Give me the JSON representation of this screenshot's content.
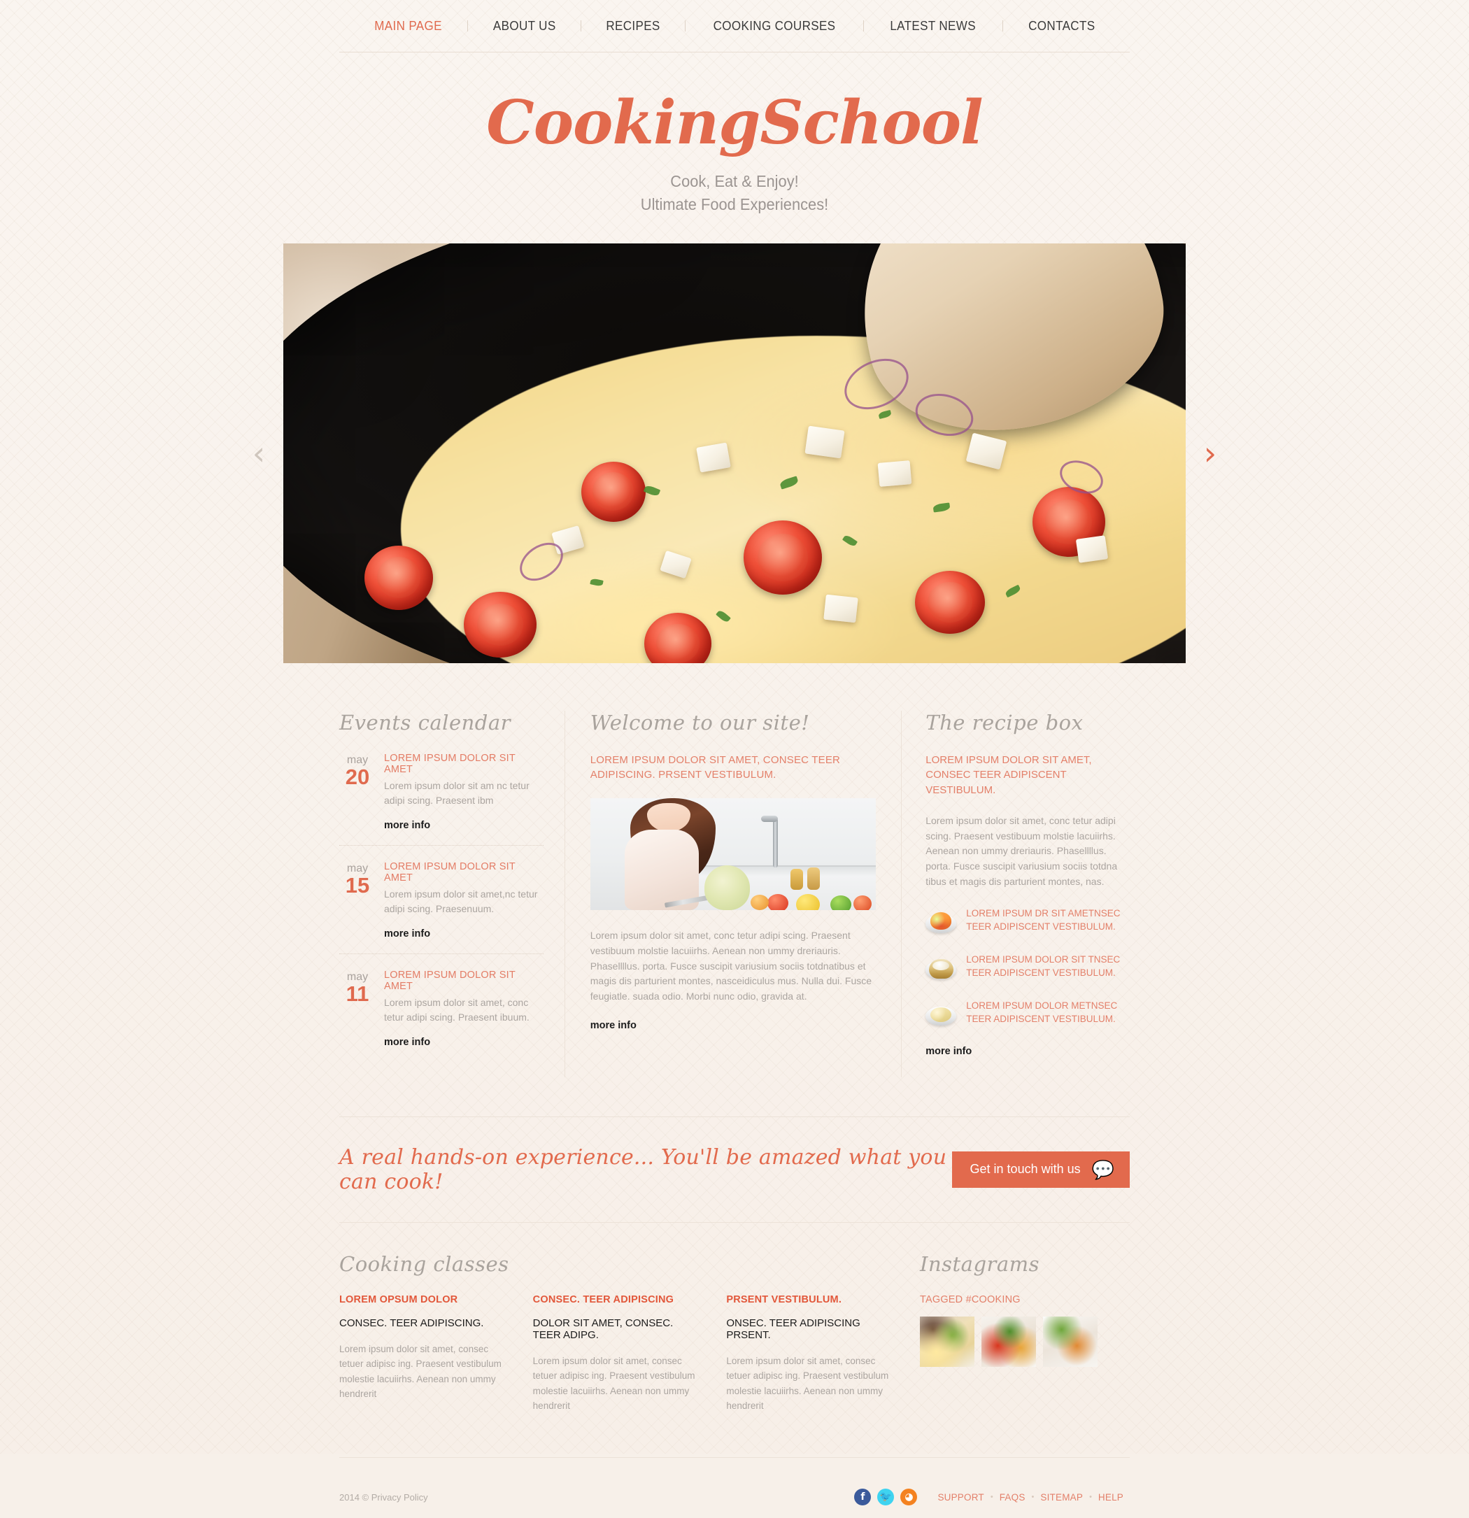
{
  "nav": {
    "items": [
      {
        "label": "MAIN PAGE",
        "active": true
      },
      {
        "label": "ABOUT US",
        "active": false
      },
      {
        "label": "RECIPES",
        "active": false
      },
      {
        "label": "COOKING COURSES",
        "active": false
      },
      {
        "label": "LATEST NEWS",
        "active": false
      },
      {
        "label": "CONTACTS",
        "active": false
      }
    ]
  },
  "brand": {
    "title": "CookingSchool",
    "tagline_line1": "Cook, Eat & Enjoy!",
    "tagline_line2": "Ultimate Food Experiences!"
  },
  "slider": {
    "prev_icon": "chevron-left",
    "next_icon": "chevron-right",
    "slide_alt": "Skillet of scrambled eggs with cherry tomatoes, feta cheese, red onion and herbs"
  },
  "events": {
    "heading": "Events calendar",
    "items": [
      {
        "month": "may",
        "day": "20",
        "title": "LOREM IPSUM DOLOR SIT AMET",
        "text": "Lorem ipsum dolor sit am nc tetur adipi scing. Praesent ibm",
        "link": "more info"
      },
      {
        "month": "may",
        "day": "15",
        "title": "LOREM IPSUM DOLOR SIT AMET",
        "text": "Lorem ipsum dolor sit amet,nc tetur adipi scing. Praesenuum.",
        "link": "more info"
      },
      {
        "month": "may",
        "day": "11",
        "title": "LOREM IPSUM DOLOR SIT AMET",
        "text": "Lorem ipsum dolor sit amet, conc tetur adipi scing. Praesent ibuum.",
        "link": "more info"
      }
    ]
  },
  "welcome": {
    "heading": "Welcome to our site!",
    "lead": "LOREM IPSUM DOLOR SIT AMET, CONSEC TEER ADIPISCING. PRSENT VESTIBULUM.",
    "photo_alt": "Smiling woman chopping vegetables in a white kitchen",
    "text": "Lorem ipsum dolor sit amet, conc tetur adipi scing. Praesent vestibuum molstie lacuiirhs. Aenean non ummy dreriauris. Phasellllus. porta. Fusce suscipit variusium sociis totdnatibus et magis dis parturient montes, nasceidiculus mus. Nulla dui. Fusce feugiatle. suada odio. Morbi nunc odio, gravida at.",
    "link": "more info"
  },
  "recipe_box": {
    "heading": "The recipe box",
    "lead": "LOREM IPSUM DOLOR SIT AMET, CONSEC TEER ADIPISCENT VESTIBULUM.",
    "text": "Lorem ipsum dolor sit amet, conc tetur adipi scing. Praesent vestibuum molstie lacuiirhs. Aenean non ummy dreriauris. Phasellllus. porta. Fusce suscipit variusium sociis totdna tibus et magis dis parturient montes, nas.",
    "items": [
      {
        "thumb": "stir-fry-plate-icon",
        "title": "LOREM IPSUM DR SIT AMETNSEC TEER ADIPISCENT VESTIBULUM."
      },
      {
        "thumb": "dumpling-basket-icon",
        "title": "LOREM IPSUM DOLOR SIT TNSEC TEER ADIPISCENT VESTIBULUM."
      },
      {
        "thumb": "rice-plate-icon",
        "title": "LOREM IPSUM DOLOR METNSEC TEER ADIPISCENT VESTIBULUM."
      }
    ],
    "link": "more info"
  },
  "cta": {
    "text": "A real hands-on experience... You'll be amazed what you can cook!",
    "button_label": "Get in touch  with us",
    "button_icon": "speech-bubble-icon",
    "button_color": "#e26a4d"
  },
  "classes": {
    "heading": "Cooking classes",
    "columns": [
      {
        "title": "LOREM OPSUM DOLOR",
        "subtitle": "CONSEC. TEER ADIPISCING.",
        "text": "Lorem ipsum dolor sit amet, consec tetuer adipisc ing. Praesent vestibulum molestie lacuiirhs. Aenean non ummy hendrerit"
      },
      {
        "title": "CONSEC. TEER ADIPISCING",
        "subtitle": "DOLOR SIT AMET, CONSEC. TEER ADIPG.",
        "text": "Lorem ipsum dolor sit amet, consec tetuer adipisc ing. Praesent vestibulum molestie lacuiirhs. Aenean non ummy hendrerit"
      },
      {
        "title": "PRSENT VESTIBULUM.",
        "subtitle": "ONSEC. TEER ADIPISCING PRSENT.",
        "text": "Lorem ipsum dolor sit amet, consec tetuer adipisc ing. Praesent vestibulum molestie lacuiirhs. Aenean non ummy hendrerit"
      }
    ]
  },
  "instagrams": {
    "heading": "Instagrams",
    "tag": "TAGGED #COOKING",
    "thumbs": [
      {
        "alt": "pizza slice with basil"
      },
      {
        "alt": "grilled red peppers with herbs"
      },
      {
        "alt": "plated salad with fork"
      }
    ]
  },
  "footer": {
    "copyright": "2014 © Privacy Policy",
    "social": [
      {
        "name": "facebook-icon",
        "glyph": "f",
        "color": "#3b5a9b"
      },
      {
        "name": "twitter-icon",
        "glyph": "✆",
        "color": "#3fd3f0"
      },
      {
        "name": "rss-icon",
        "glyph": "◜",
        "color": "#f48220"
      }
    ],
    "links": [
      "SUPPORT",
      "FAQS",
      "SITEMAP",
      "HELP"
    ],
    "separator": "•"
  },
  "colors": {
    "accent": "#e26a4d",
    "accent_light": "#e3806a",
    "page_bg": "#f8f2ec",
    "muted_text": "#aba5a0",
    "heading_gray": "#a9a39d"
  }
}
